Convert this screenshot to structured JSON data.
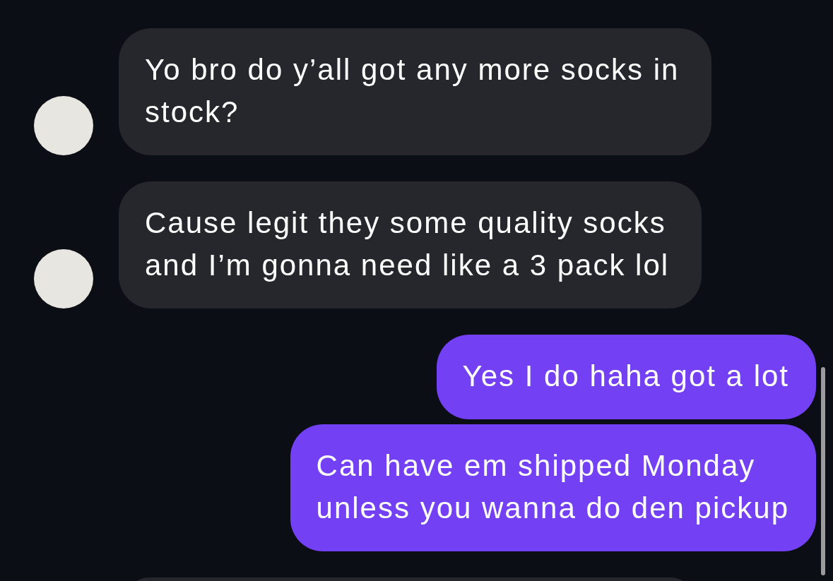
{
  "messages": [
    {
      "kind": "received",
      "text": "Yo bro do y’all got any more socks in\nstock?"
    },
    {
      "kind": "received",
      "text": "Cause legit they some quality socks\nand I’m gonna need like a 3 pack lol"
    },
    {
      "kind": "sent",
      "text": "Yes I do haha got a lot"
    },
    {
      "kind": "sent",
      "text": "Can have em shipped Monday\nunless you wanna do den pickup"
    },
    {
      "kind": "received",
      "cut_off": true
    }
  ]
}
